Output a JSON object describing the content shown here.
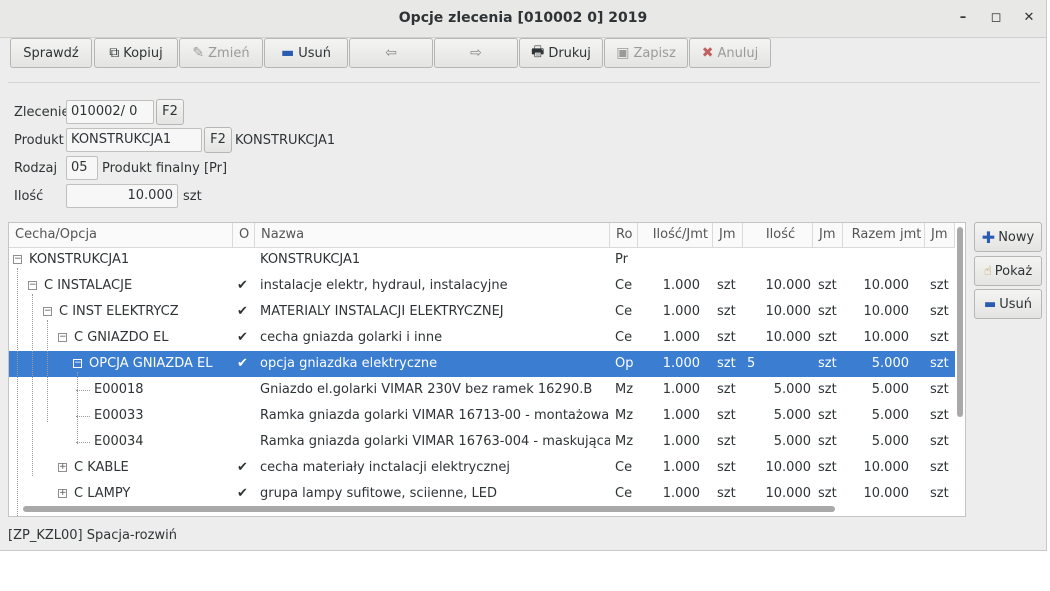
{
  "window": {
    "title": "Opcje zlecenia [010002  0] 2019"
  },
  "toolbar": {
    "check": "Sprawdź",
    "copy": "Kopiuj",
    "change": "Zmień",
    "delete": "Usuń",
    "print": "Drukuj",
    "save": "Zapisz",
    "cancel": "Anuluj"
  },
  "form": {
    "order_label": "Zlecenie",
    "order_value": "010002/  0",
    "f2": "F2",
    "product_label": "Produkt",
    "product_value": "KONSTRUKCJA1",
    "product_name": "KONSTRUKCJA1",
    "type_label": "Rodzaj",
    "type_value": "05",
    "type_desc": "Produkt finalny  [Pr]",
    "qty_label": "Ilość",
    "qty_value": "10.000",
    "qty_unit": "szt"
  },
  "table": {
    "headers": [
      "Cecha/Opcja",
      "O",
      "Nazwa",
      "Ro",
      "Ilość/Jmt",
      "Jm",
      "Ilość",
      "Jm",
      "Razem jmt",
      "Jm"
    ],
    "rows": [
      {
        "name": "KONSTRUKCJA1",
        "o": "",
        "nazwa": "KONSTRUKCJA1",
        "ro": "Pr",
        "ilj": "",
        "jm1": "",
        "il": "",
        "jm2": "",
        "raz": "",
        "jm3": ""
      },
      {
        "name": "C INSTALACJE",
        "o": "✔",
        "nazwa": "instalacje elektr, hydraul, instalacyjne",
        "ro": "Ce",
        "ilj": "1.000",
        "jm1": "szt",
        "il": "10.000",
        "jm2": "szt",
        "raz": "10.000",
        "jm3": "szt"
      },
      {
        "name": "C INST ELEKTRYCZ",
        "o": "✔",
        "nazwa": "MATERIALY INSTALACJI ELEKTRYCZNEJ",
        "ro": "Ce",
        "ilj": "1.000",
        "jm1": "szt",
        "il": "10.000",
        "jm2": "szt",
        "raz": "10.000",
        "jm3": "szt"
      },
      {
        "name": "C GNIAZDO EL",
        "o": "✔",
        "nazwa": "cecha gniazda golarki i inne",
        "ro": "Ce",
        "ilj": "1.000",
        "jm1": "szt",
        "il": "10.000",
        "jm2": "szt",
        "raz": "10.000",
        "jm3": "szt"
      },
      {
        "name": "OPCJA GNIAZDA EL",
        "o": "✔",
        "nazwa": "opcja gniazdka elektryczne",
        "ro": "Op",
        "ilj": "1.000",
        "jm1": "szt",
        "il": "5",
        "jm2": "szt",
        "raz": "5.000",
        "jm3": "szt"
      },
      {
        "name": "E00018",
        "o": "",
        "nazwa": "Gniazdo el.golarki VIMAR 230V bez ramek 16290.B",
        "ro": "Mz",
        "ilj": "1.000",
        "jm1": "szt",
        "il": "5.000",
        "jm2": "szt",
        "raz": "5.000",
        "jm3": "szt"
      },
      {
        "name": "E00033",
        "o": "",
        "nazwa": "Ramka gniazda golarki VIMAR 16713-00 - montażowa",
        "ro": "Mz",
        "ilj": "1.000",
        "jm1": "szt",
        "il": "5.000",
        "jm2": "szt",
        "raz": "5.000",
        "jm3": "szt"
      },
      {
        "name": "E00034",
        "o": "",
        "nazwa": "Ramka gniazda golarki VIMAR 16763-004 - maskująca",
        "ro": "Mz",
        "ilj": "1.000",
        "jm1": "szt",
        "il": "5.000",
        "jm2": "szt",
        "raz": "5.000",
        "jm3": "szt"
      },
      {
        "name": "C KABLE",
        "o": "✔",
        "nazwa": "cecha materiały inctalacji elektrycznej",
        "ro": "Ce",
        "ilj": "1.000",
        "jm1": "szt",
        "il": "10.000",
        "jm2": "szt",
        "raz": "10.000",
        "jm3": "szt"
      },
      {
        "name": "C LAMPY",
        "o": "✔",
        "nazwa": "grupa lampy sufitowe, sciienne, LED",
        "ro": "Ce",
        "ilj": "1.000",
        "jm1": "szt",
        "il": "10.000",
        "jm2": "szt",
        "raz": "10.000",
        "jm3": "szt"
      }
    ]
  },
  "side": {
    "new": "Nowy",
    "show": "Pokaż",
    "delete": "Usuń"
  },
  "status": "[ZP_KZL00] Spacja-rozwiń"
}
